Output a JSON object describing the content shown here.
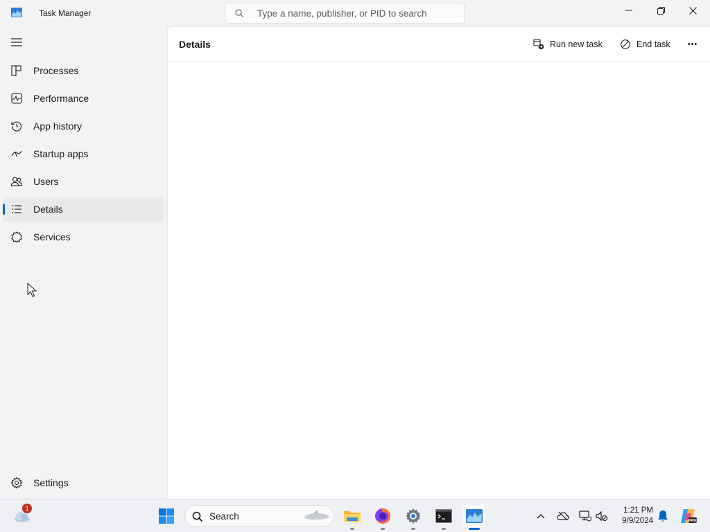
{
  "window": {
    "title": "Task Manager",
    "search_placeholder": "Type a name, publisher, or PID to search"
  },
  "sidebar": {
    "items": [
      {
        "label": "Processes",
        "icon": "processes-icon"
      },
      {
        "label": "Performance",
        "icon": "performance-icon"
      },
      {
        "label": "App history",
        "icon": "history-icon"
      },
      {
        "label": "Startup apps",
        "icon": "startup-icon"
      },
      {
        "label": "Users",
        "icon": "users-icon"
      },
      {
        "label": "Details",
        "icon": "details-icon",
        "selected": true
      },
      {
        "label": "Services",
        "icon": "services-icon"
      }
    ],
    "settings_label": "Settings"
  },
  "main": {
    "title": "Details",
    "run_new_task_label": "Run new task",
    "end_task_label": "End task",
    "more_label": "•••"
  },
  "taskbar": {
    "search_label": "Search",
    "weather_badge": "1",
    "time": "1:21 PM",
    "date": "9/9/2024",
    "accent_color": "#0067c0"
  }
}
